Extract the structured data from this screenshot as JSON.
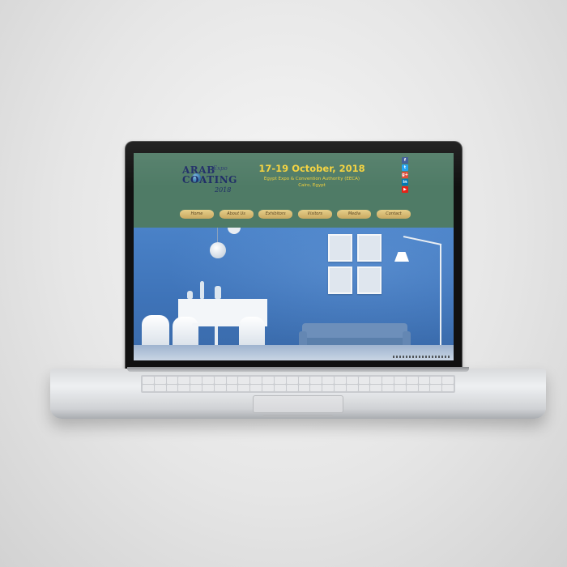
{
  "site": {
    "logo": {
      "line1": "ARAB",
      "expo": "Expo",
      "line2": "COATING",
      "year": "2018"
    },
    "event": {
      "dates": "17-19 October, 2018",
      "venue": "Egypt Expo & Convention Authority (EECA)",
      "city": "Cairo, Egypt"
    },
    "social": [
      {
        "icon": "facebook-icon",
        "glyph": "f"
      },
      {
        "icon": "twitter-icon",
        "glyph": "t"
      },
      {
        "icon": "google-plus-icon",
        "glyph": "g+"
      },
      {
        "icon": "linkedin-icon",
        "glyph": "in"
      },
      {
        "icon": "youtube-icon",
        "glyph": "▶"
      }
    ],
    "nav": [
      {
        "label": "Home"
      },
      {
        "label": "About Us"
      },
      {
        "label": "Exhibitors"
      },
      {
        "label": "Visitors"
      },
      {
        "label": "Media"
      },
      {
        "label": "Contact"
      }
    ]
  },
  "colors": {
    "header_bg": "#4f7b66",
    "date_text": "#f4d23c",
    "nav_button": "#d9bd75",
    "wall": "#4a82c8"
  }
}
